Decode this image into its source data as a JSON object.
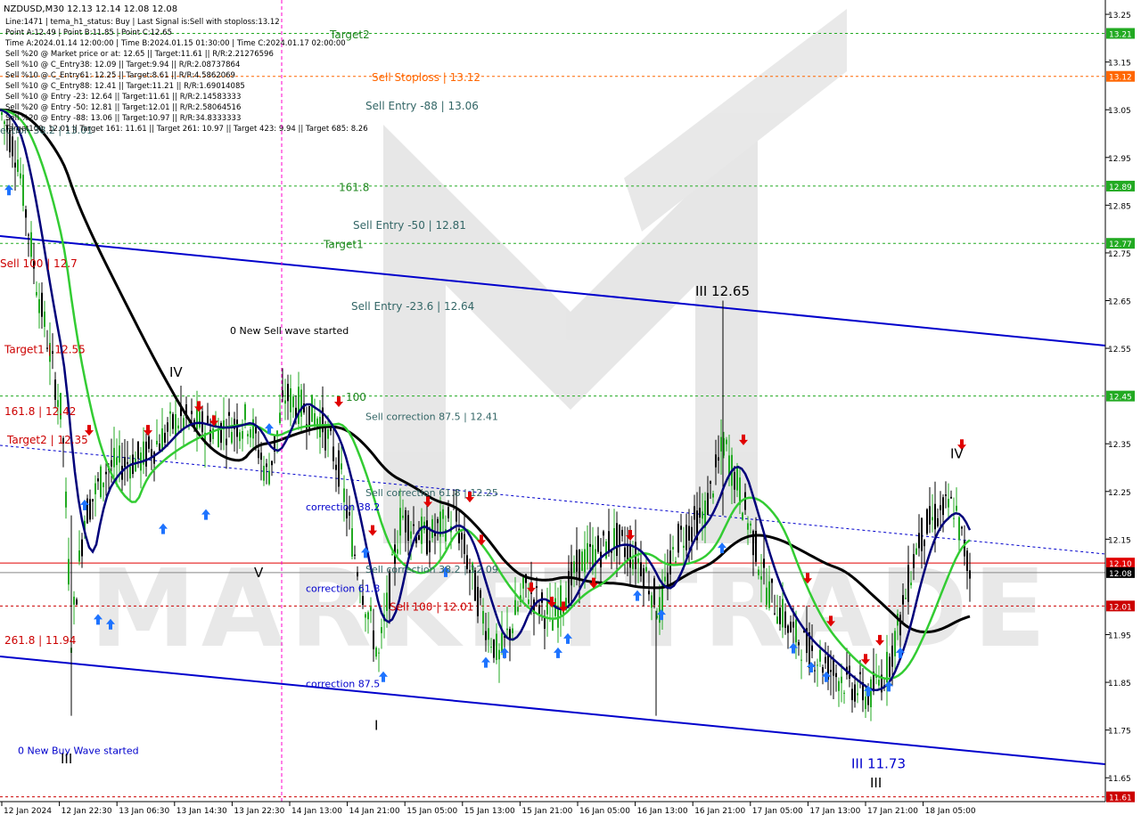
{
  "chart_data": {
    "type": "candlestick",
    "symbol": "NZDUSD,M30",
    "header": {
      "symbol_line": "NZDUSD,M30  12.13 12.14 12.08 12.08",
      "lines": [
        "Line:1471 | tema_h1_status: Buy | Last Signal is:Sell with stoploss:13.12",
        "Point A:12.49 | Point B:11.85 | Point C:12.65",
        "Time A:2024.01.14 12:00:00 | Time B:2024.01.15 01:30:00 | Time C:2024.01.17 02:00:00",
        "Sell %20 @ Market price or at: 12.65 || Target:11.61 || R/R:2.21276596",
        "Sell %10 @ C_Entry38: 12.09 || Target:9.94 || R/R:2.08737864",
        "Sell %10 @ C_Entry61: 12.25 || Target:8.61 || R/R:4.5862069",
        "Sell %10 @ C_Entry88: 12.41 || Target:11.21 || R/R:1.69014085",
        "Sell %10 @ Entry -23: 12.64 || Target:11.61 || R/R:2.14583333",
        "Sell %20 @ Entry -50: 12.81 || Target:12.01 || R/R:2.58064516",
        "Sell %20 @ Entry -88: 13.06 || Target:10.97 || R/R:34.8333333",
        "Target100: 12.01 || Target 161: 11.61 || Target 261: 10.97 || Target 423: 9.94 || Target 685: 8.26"
      ]
    },
    "y_axis": {
      "ticks": [
        "13.25",
        "13.15",
        "13.05",
        "12.95",
        "12.85",
        "12.75",
        "12.65",
        "12.55",
        "12.35",
        "12.25",
        "12.15",
        "11.95",
        "11.85",
        "11.75",
        "11.65"
      ],
      "ylim": [
        11.6,
        13.28
      ]
    },
    "x_axis": {
      "ticks": [
        "12 Jan 2024",
        "12 Jan 22:30",
        "13 Jan 06:30",
        "13 Jan 14:30",
        "13 Jan 22:30",
        "14 Jan 13:00",
        "14 Jan 21:00",
        "15 Jan 05:00",
        "15 Jan 13:00",
        "15 Jan 21:00",
        "16 Jan 05:00",
        "16 Jan 13:00",
        "16 Jan 21:00",
        "17 Jan 05:00",
        "17 Jan 13:00",
        "17 Jan 21:00",
        "18 Jan 05:00"
      ]
    },
    "price_labels": [
      {
        "value": 13.21,
        "text": "13.21",
        "color": "#22aa22"
      },
      {
        "value": 13.12,
        "text": "13.12",
        "color": "#ff6600"
      },
      {
        "value": 12.89,
        "text": "12.89",
        "color": "#22aa22"
      },
      {
        "value": 12.77,
        "text": "12.77",
        "color": "#22aa22"
      },
      {
        "value": 12.45,
        "text": "12.45",
        "color": "#22aa22"
      },
      {
        "value": 12.1,
        "text": "12.10",
        "color": "#e00000"
      },
      {
        "value": 12.08,
        "text": "12.08",
        "color": "#000000"
      },
      {
        "value": 12.01,
        "text": "12.01",
        "color": "#cc0000"
      },
      {
        "value": 11.61,
        "text": "11.61",
        "color": "#cc0000"
      }
    ],
    "level_labels": [
      {
        "text": "Target2",
        "value": 13.2,
        "color": "#228822"
      },
      {
        "text": "Sell Stoploss | 13.12",
        "value": 13.11,
        "color": "#ff6600"
      },
      {
        "text": "Sell Entry -88 | 13.06",
        "value": 13.05,
        "color": "#336666"
      },
      {
        "text": "161.8",
        "value": 12.88,
        "color": "#228822"
      },
      {
        "text": "Sell Entry -50 | 12.81",
        "value": 12.8,
        "color": "#336666"
      },
      {
        "text": "Target1",
        "value": 12.76,
        "color": "#228822"
      },
      {
        "text": "III 12.65",
        "value": 12.66,
        "color": "#000000"
      },
      {
        "text": "Sell Entry -23.6 | 12.64",
        "value": 12.63,
        "color": "#336666"
      },
      {
        "text": "0 New Sell wave started",
        "value": 12.58,
        "color": "#000000"
      },
      {
        "text": "100",
        "value": 12.44,
        "color": "#228822"
      },
      {
        "text": "Sell correction 87.5 | 12.41",
        "value": 12.4,
        "color": "#336666"
      },
      {
        "text": "Sell correction 61.8 | 12.25",
        "value": 12.24,
        "color": "#336666"
      },
      {
        "text": "correction 38.2",
        "value": 12.21,
        "color": "#0000cc"
      },
      {
        "text": "Sell correction 38.2 | 12.09",
        "value": 12.08,
        "color": "#336666"
      },
      {
        "text": "correction 61.8",
        "value": 12.04,
        "color": "#0000cc"
      },
      {
        "text": "Sell 100 | 12.01",
        "value": 12.0,
        "color": "#cc0000"
      },
      {
        "text": "correction 87.5",
        "value": 11.84,
        "color": "#0000cc"
      },
      {
        "text": "0 New Buy Wave started",
        "value": 11.7,
        "color": "#0000cc"
      },
      {
        "text": "III 11.73",
        "value": 11.67,
        "color": "#0000cc"
      },
      {
        "text": "Target1 | 12.55",
        "value": 12.54,
        "color": "#cc0000"
      },
      {
        "text": "161.8 | 12.42",
        "value": 12.41,
        "color": "#cc0000"
      },
      {
        "text": "Target2 | 12.35",
        "value": 12.35,
        "color": "#cc0000"
      },
      {
        "text": "261.8 | 11.94",
        "value": 11.93,
        "color": "#cc0000"
      },
      {
        "text": "Sell 100 | 12.7",
        "value": 12.72,
        "color": "#cc0000"
      },
      {
        "text": "ection 38.2 | 13.01",
        "value": 13.0,
        "color": "#336666"
      }
    ],
    "wave_labels": [
      {
        "text": "IV",
        "value": 12.49
      },
      {
        "text": "V",
        "value": 12.07
      },
      {
        "text": "I",
        "value": 11.75
      },
      {
        "text": "III",
        "value": 11.68
      },
      {
        "text": "IV",
        "value": 12.32
      },
      {
        "text": "III",
        "value": 11.63
      }
    ],
    "watermark": "MARKETTRADE",
    "colors": {
      "channel": "#0000cc",
      "ma_black": "#000000",
      "ma_green": "#33cc33",
      "ma_navy": "#00007a",
      "bull_arrow": "#1e73ff",
      "bear_arrow": "#e00000"
    }
  }
}
